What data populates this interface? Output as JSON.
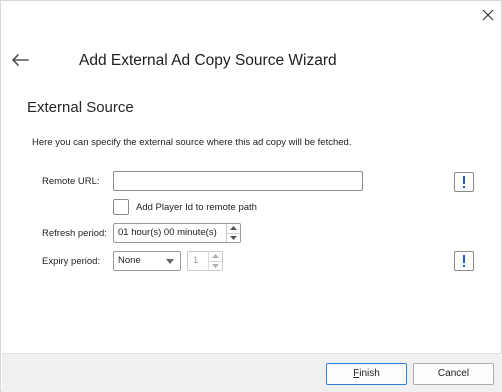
{
  "window": {
    "title": "Add External Ad Copy Source Wizard"
  },
  "section": {
    "title": "External Source",
    "description": "Here you can specify the external source where this ad copy will be fetched."
  },
  "form": {
    "remote_url": {
      "label": "Remote URL:",
      "value": "",
      "placeholder": ""
    },
    "add_player_id": {
      "label": "Add Player Id to remote path",
      "checked": false
    },
    "refresh_period": {
      "label": "Refresh period:",
      "value": "01 hour(s) 00 minute(s)"
    },
    "expiry_period": {
      "label": "Expiry period:",
      "select_value": "None",
      "count_value": "1"
    }
  },
  "footer": {
    "finish_label_first": "F",
    "finish_label_rest": "inish",
    "cancel_label": "Cancel"
  },
  "icons": {
    "close": "close-icon",
    "back": "arrow-left-icon",
    "info": "exclamation-icon"
  },
  "colors": {
    "accent": "#2f7ed8",
    "info_icon": "#1f5fbf",
    "footer_bg": "#f0f0f0"
  }
}
